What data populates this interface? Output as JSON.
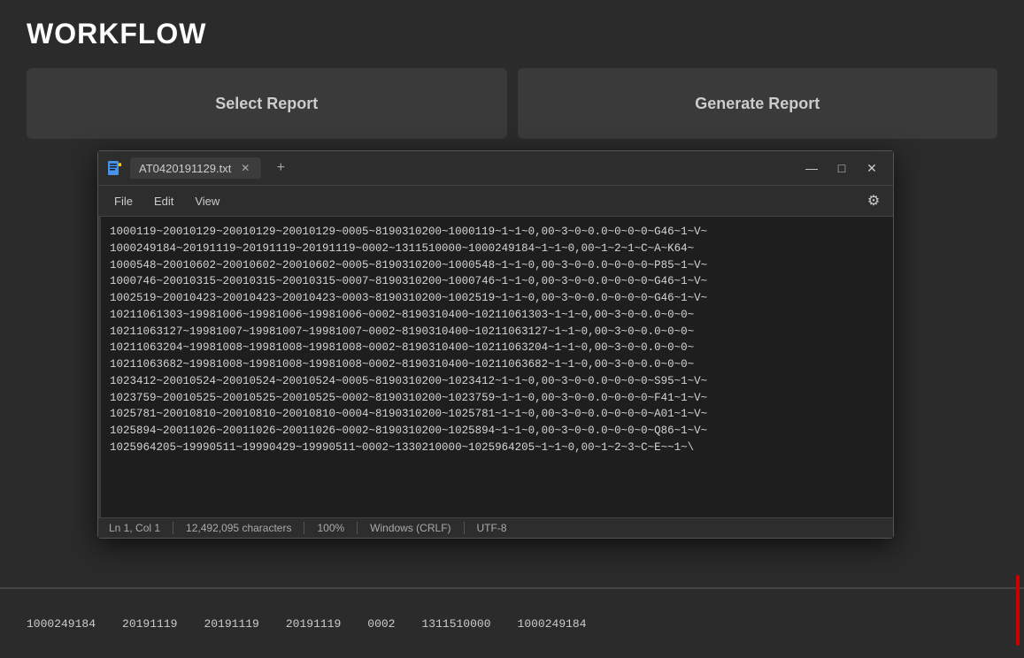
{
  "header": {
    "title": "WORKFLOW"
  },
  "panels": [
    {
      "id": "select-report",
      "label": "Select Report"
    },
    {
      "id": "generate-report",
      "label": "Generate Report"
    }
  ],
  "notepad": {
    "icon": "notepad-icon",
    "tab_filename": "AT0420191129.txt",
    "tab_close_label": "×",
    "new_tab_label": "+",
    "window_controls": {
      "minimize": "—",
      "maximize": "□",
      "close": "✕"
    },
    "menu": {
      "file": "File",
      "edit": "Edit",
      "view": "View"
    },
    "content_lines": [
      "1000119~20010129~20010129~20010129~0005~8190310200~1000119~1~1~0,00~3~0~0.0~0~0~0~G46~1~V~",
      "1000249184~20191119~20191119~20191119~0002~1311510000~1000249184~1~1~0,00~1~2~1~C~A~K64~",
      "1000548~20010602~20010602~20010602~0005~8190310200~1000548~1~1~0,00~3~0~0.0~0~0~0~P85~1~V~",
      "1000746~20010315~20010315~20010315~0007~8190310200~1000746~1~1~0,00~3~0~0.0~0~0~0~G46~1~V~",
      "1002519~20010423~20010423~20010423~0003~8190310200~1002519~1~1~0,00~3~0~0.0~0~0~0~G46~1~V~",
      "10211061303~19981006~19981006~19981006~0002~8190310400~10211061303~1~1~0,00~3~0~0.0~0~0~",
      "10211063127~19981007~19981007~19981007~0002~8190310400~10211063127~1~1~0,00~3~0~0.0~0~0~",
      "10211063204~19981008~19981008~19981008~0002~8190310400~10211063204~1~1~0,00~3~0~0.0~0~0~",
      "10211063682~19981008~19981008~19981008~0002~8190310400~10211063682~1~1~0,00~3~0~0.0~0~0~",
      "1023412~20010524~20010524~20010524~0005~8190310200~1023412~1~1~0,00~3~0~0.0~0~0~0~S95~1~V~",
      "1023759~20010525~20010525~20010525~0002~8190310200~1023759~1~1~0,00~3~0~0.0~0~0~0~F41~1~V~",
      "1025781~20010810~20010810~20010810~0004~8190310200~1025781~1~1~0,00~3~0~0.0~0~0~0~A01~1~V~",
      "1025894~20011026~20011026~20011026~0002~8190310200~1025894~1~1~0,00~3~0~0.0~0~0~0~Q86~1~V~",
      "1025964205~19990511~19990429~19990511~0002~1330210000~1025964205~1~1~0,00~1~2~3~C~E~~1~\\"
    ],
    "statusbar": {
      "position": "Ln 1, Col 1",
      "characters": "12,492,095 characters",
      "zoom": "100%",
      "line_endings": "Windows (CRLF)",
      "encoding": "UTF-8"
    }
  },
  "bottom_row": {
    "values": [
      "1000249184",
      "20191119",
      "20191119",
      "20191119",
      "0002",
      "1311510000",
      "1000249184"
    ]
  }
}
